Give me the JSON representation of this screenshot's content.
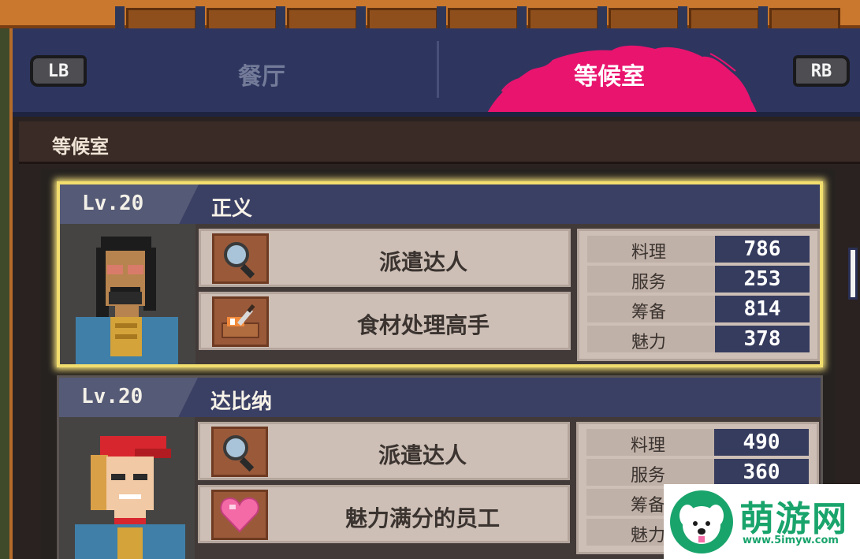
{
  "controls": {
    "left_bumper": "LB",
    "right_bumper": "RB"
  },
  "tabs": [
    {
      "label": "餐厅",
      "active": false
    },
    {
      "label": "等候室",
      "active": true
    }
  ],
  "section": {
    "title": "等候室"
  },
  "staff": [
    {
      "level": "Lv.20",
      "name": "正义",
      "selected": true,
      "skills": [
        {
          "label": "派遣达人",
          "icon": "magnifier-icon"
        },
        {
          "label": "食材处理高手",
          "icon": "cutting-board-icon"
        }
      ],
      "stats": [
        {
          "label": "料理",
          "value": "786"
        },
        {
          "label": "服务",
          "value": "253"
        },
        {
          "label": "筹备",
          "value": "814"
        },
        {
          "label": "魅力",
          "value": "378"
        }
      ]
    },
    {
      "level": "Lv.20",
      "name": "达比纳",
      "selected": false,
      "skills": [
        {
          "label": "派遣达人",
          "icon": "magnifier-icon"
        },
        {
          "label": "魅力满分的员工",
          "icon": "heart-icon"
        }
      ],
      "stats": [
        {
          "label": "料理",
          "value": "490"
        },
        {
          "label": "服务",
          "value": "360"
        },
        {
          "label": "筹备",
          "value": ""
        },
        {
          "label": "魅力",
          "value": ""
        }
      ]
    }
  ],
  "watermark": {
    "text": "萌游网",
    "url": "www.5imyw.com"
  },
  "colors": {
    "accent": "#e8146e",
    "selection": "#f2de6e",
    "panel": "#2e3660",
    "watermark": "#19a46c"
  }
}
